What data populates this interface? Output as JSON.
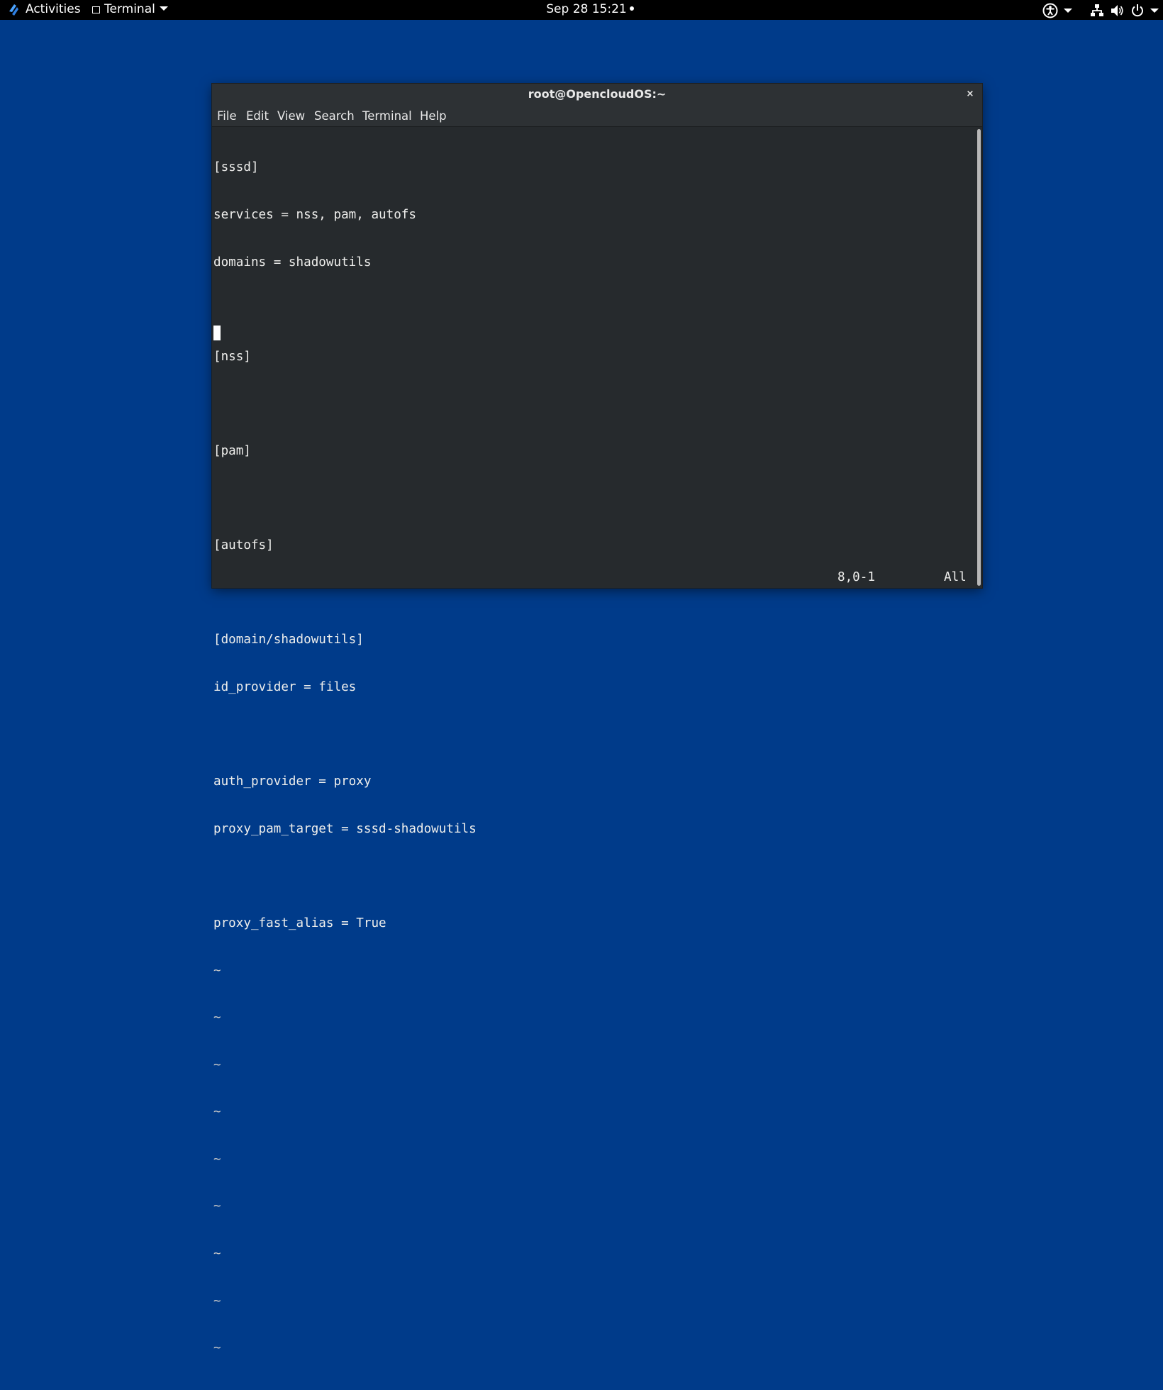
{
  "topbar": {
    "activities_label": "Activities",
    "app_menu_label": "Terminal",
    "clock": "Sep 28  15:21"
  },
  "window": {
    "title": "root@OpencloudOS:~",
    "close_glyph": "×"
  },
  "menu": {
    "file": "File",
    "edit": "Edit",
    "view": "View",
    "search": "Search",
    "terminal": "Terminal",
    "help": "Help"
  },
  "editor": {
    "lines": [
      "[sssd]",
      "services = nss, pam, autofs",
      "domains = shadowutils",
      "",
      "[nss]",
      "",
      "[pam]",
      "",
      "[autofs]",
      "",
      "[domain/shadowutils]",
      "id_provider = files",
      "",
      "auth_provider = proxy",
      "proxy_pam_target = sssd-shadowutils",
      "",
      "proxy_fast_alias = True"
    ],
    "tilde_lines": [
      "~",
      "~",
      "~",
      "~",
      "~",
      "~",
      "~",
      "~",
      "~",
      "~",
      "~"
    ],
    "status_position": "8,0-1",
    "status_scroll": "All"
  },
  "icons": {
    "logo": "opencloudos-logo-icon",
    "accessibility": "accessibility-icon",
    "network": "network-icon",
    "volume": "volume-icon",
    "power": "power-icon"
  },
  "colors": {
    "desktop": "#003b8a",
    "terminal_bg": "#262a2d",
    "titlebar_bg": "#2d3134",
    "text": "#eeeeec"
  }
}
